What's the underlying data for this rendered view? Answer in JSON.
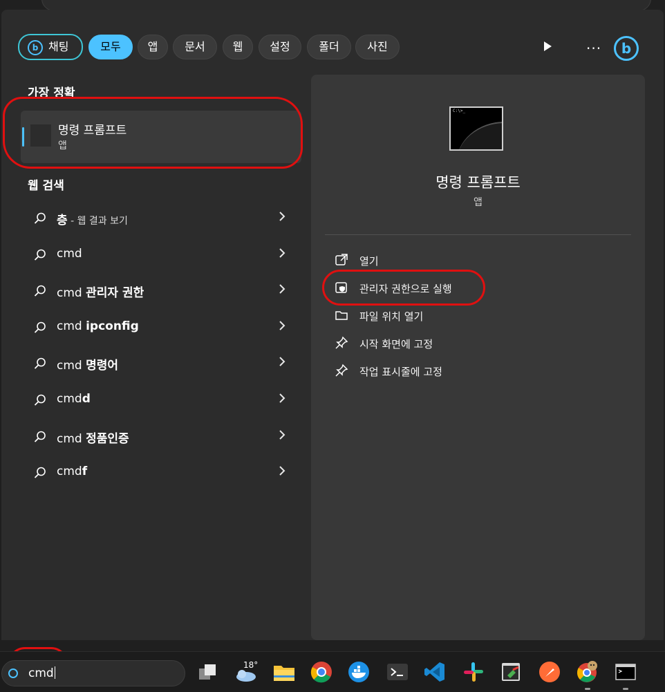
{
  "filters": {
    "chat": "채팅",
    "tabs": [
      "모두",
      "앱",
      "문서",
      "웹",
      "설정",
      "폴더",
      "사진"
    ],
    "active_index": 0
  },
  "toolbar": {
    "play_icon": "play-icon",
    "more_label": "···",
    "bing_icon": "bing-icon",
    "bing_letter": "b"
  },
  "best_match": {
    "section": "가장 정확",
    "name": "명령 프롬프트",
    "type": "앱"
  },
  "web_search": {
    "section": "웹 검색",
    "items": [
      {
        "normal": "",
        "bold": "층",
        "suffix": " - 웹 결과 보기"
      },
      {
        "normal": "cmd",
        "bold": "",
        "suffix": ""
      },
      {
        "normal": "cmd ",
        "bold": "관리자 권한",
        "suffix": ""
      },
      {
        "normal": "cmd ",
        "bold": "ipconfig",
        "suffix": ""
      },
      {
        "normal": "cmd ",
        "bold": "명령어",
        "suffix": ""
      },
      {
        "normal": "cmd",
        "bold": "d",
        "suffix": ""
      },
      {
        "normal": "cmd ",
        "bold": "정품인증",
        "suffix": ""
      },
      {
        "normal": "cmd",
        "bold": "f",
        "suffix": ""
      }
    ]
  },
  "detail": {
    "thumb_prompt": "C:\\>_",
    "title": "명령 프롬프트",
    "subtitle": "앱",
    "actions": [
      {
        "label": "열기",
        "icon": "open-external-icon"
      },
      {
        "label": "관리자 권한으로 실행",
        "icon": "shield-icon"
      },
      {
        "label": "파일 위치 열기",
        "icon": "folder-icon"
      },
      {
        "label": "시작 화면에 고정",
        "icon": "pin-icon"
      },
      {
        "label": "작업 표시줄에 고정",
        "icon": "pin-icon"
      }
    ]
  },
  "taskbar": {
    "search_value": "cmd",
    "weather_temp": "18°",
    "apps": [
      "task-view-icon",
      "weather-icon",
      "file-explorer-icon",
      "chrome-icon",
      "docker-icon",
      "terminal-icon",
      "vscode-icon",
      "slack-icon",
      "tool-icon",
      "postman-icon",
      "chrome-profile-icon",
      "cmd-icon"
    ]
  },
  "colors": {
    "accent": "#4cc2ff",
    "annotation": "#e01010",
    "panel": "#2c2c2c",
    "detail": "#383838"
  }
}
